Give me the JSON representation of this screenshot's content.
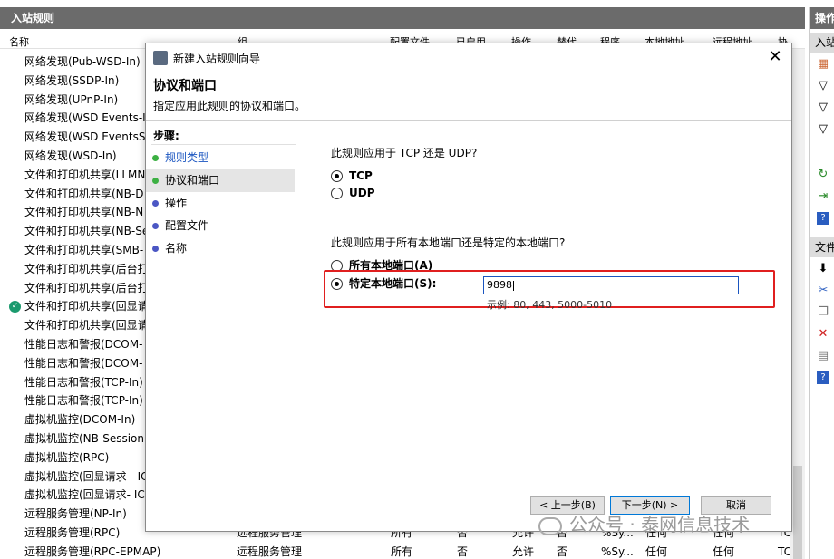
{
  "background": {
    "title": "入站规则",
    "columns": [
      "名称",
      "组",
      "配置文件",
      "已启用",
      "操作",
      "替代",
      "程序",
      "本地地址",
      "远程地址",
      "协"
    ],
    "rows": [
      {
        "name": "网络发现(Pub-WSD-In)",
        "checked": false
      },
      {
        "name": "网络发现(SSDP-In)",
        "checked": false
      },
      {
        "name": "网络发现(UPnP-In)",
        "checked": false
      },
      {
        "name": "网络发现(WSD Events-In)",
        "checked": false
      },
      {
        "name": "网络发现(WSD EventsSec",
        "checked": false
      },
      {
        "name": "网络发现(WSD-In)",
        "checked": false
      },
      {
        "name": "文件和打印机共享(LLMN",
        "checked": false
      },
      {
        "name": "文件和打印机共享(NB-D",
        "checked": false
      },
      {
        "name": "文件和打印机共享(NB-N",
        "checked": false
      },
      {
        "name": "文件和打印机共享(NB-Se",
        "checked": false
      },
      {
        "name": "文件和打印机共享(SMB-",
        "checked": false
      },
      {
        "name": "文件和打印机共享(后台打",
        "checked": false
      },
      {
        "name": "文件和打印机共享(后台打",
        "checked": false
      },
      {
        "name": "文件和打印机共享(回显请",
        "checked": true
      },
      {
        "name": "文件和打印机共享(回显请",
        "checked": false
      },
      {
        "name": "性能日志和警报(DCOM-",
        "checked": false
      },
      {
        "name": "性能日志和警报(DCOM-",
        "checked": false
      },
      {
        "name": "性能日志和警报(TCP-In)",
        "checked": false
      },
      {
        "name": "性能日志和警报(TCP-In)",
        "checked": false
      },
      {
        "name": "虚拟机监控(DCOM-In)",
        "checked": false
      },
      {
        "name": "虚拟机监控(NB-Session-",
        "checked": false
      },
      {
        "name": "虚拟机监控(RPC)",
        "checked": false
      },
      {
        "name": "虚拟机监控(回显请求 - IC",
        "checked": false
      },
      {
        "name": "虚拟机监控(回显请求- IC",
        "checked": false
      },
      {
        "name": "远程服务管理(NP-In)",
        "checked": false
      },
      {
        "name": "远程服务管理(RPC)",
        "checked": false,
        "group": "远程服务管理",
        "profile": "所有",
        "enabled": "否",
        "action": "允许",
        "override": "否",
        "program": "%Sy...",
        "local": "任何",
        "remote": "任何",
        "proto": "TC"
      },
      {
        "name": "远程服务管理(RPC-EPMAP)",
        "checked": false,
        "group": "远程服务管理",
        "profile": "所有",
        "enabled": "否",
        "action": "允许",
        "override": "否",
        "program": "%Sy...",
        "local": "任何",
        "remote": "任何",
        "proto": "TC"
      }
    ]
  },
  "actions_pane": {
    "header": "操作",
    "section1": "入站",
    "section2": "文件"
  },
  "dialog": {
    "window_title": "新建入站规则向导",
    "heading": "协议和端口",
    "subheading": "指定应用此规则的协议和端口。",
    "steps_label": "步骤:",
    "steps": [
      {
        "label": "规则类型",
        "state": "done"
      },
      {
        "label": "协议和端口",
        "state": "current"
      },
      {
        "label": "操作",
        "state": "todo"
      },
      {
        "label": "配置文件",
        "state": "todo"
      },
      {
        "label": "名称",
        "state": "todo"
      }
    ],
    "question_protocol": "此规则应用于 TCP 还是 UDP?",
    "protocol_options": [
      "TCP",
      "UDP"
    ],
    "protocol_selected": "TCP",
    "question_port": "此规则应用于所有本地端口还是特定的本地端口?",
    "port_option_all": "所有本地端口(A)",
    "port_option_specific": "特定本地端口(S):",
    "port_selected": "specific",
    "port_value": "9898",
    "port_example": "示例: 80, 443, 5000-5010",
    "buttons": {
      "back": "< 上一步(B)",
      "next": "下一步(N) >",
      "cancel": "取消"
    }
  },
  "watermark": "公众号 · 泰网信息技术",
  "colors": {
    "header_gray": "#6b6b6b",
    "highlight_red": "#e01f1f",
    "step_done_dot": "#3cb043",
    "step_todo_dot": "#4b57c4",
    "link_blue": "#1a55c0",
    "check_green": "#1b9a6e"
  }
}
